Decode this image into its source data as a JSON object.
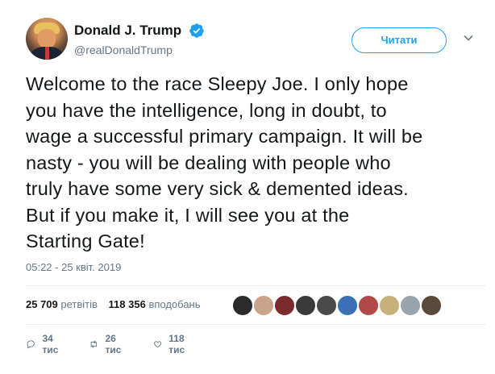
{
  "author": {
    "display_name": "Donald J. Trump",
    "handle": "@realDonaldTrump",
    "verified": true
  },
  "follow_button": {
    "label": "Читати"
  },
  "tweet": {
    "text": "Welcome to the race Sleepy Joe. I only hope\nyou have the intelligence, long in doubt, to\nwage a successful primary campaign. It will be\nnasty - you will be dealing with people who\ntruly have some very sick & demented ideas.\nBut if you make it, I will see you at the\nStarting Gate!",
    "timestamp": "05:22 - 25 квіт. 2019"
  },
  "stats": {
    "retweets_count": "25 709",
    "retweets_label": "ретвітів",
    "likes_count": "118 356",
    "likes_label": "вподобань"
  },
  "likers": [
    {
      "name": "liker-1",
      "color": "#2b2b2b"
    },
    {
      "name": "liker-2",
      "color": "#c9a48a"
    },
    {
      "name": "liker-3",
      "color": "#7a2b2b"
    },
    {
      "name": "liker-4",
      "color": "#3a3a3a"
    },
    {
      "name": "liker-5",
      "color": "#4a4a4a"
    },
    {
      "name": "liker-6",
      "color": "#3b6fb6"
    },
    {
      "name": "liker-7",
      "color": "#b04a4a"
    },
    {
      "name": "liker-8",
      "color": "#c8b07a"
    },
    {
      "name": "liker-9",
      "color": "#9aa4ad"
    },
    {
      "name": "liker-10",
      "color": "#5a4a3a"
    }
  ],
  "actions": {
    "replies": "34 тис",
    "retweets": "26 тис",
    "likes": "118 тис"
  },
  "colors": {
    "accent": "#1da1f2",
    "muted": "#657786",
    "text": "#14171a"
  },
  "icons": {
    "verified": "verified-badge-icon",
    "chevron": "chevron-down-icon",
    "reply": "reply-icon",
    "retweet": "retweet-icon",
    "like": "heart-icon"
  }
}
